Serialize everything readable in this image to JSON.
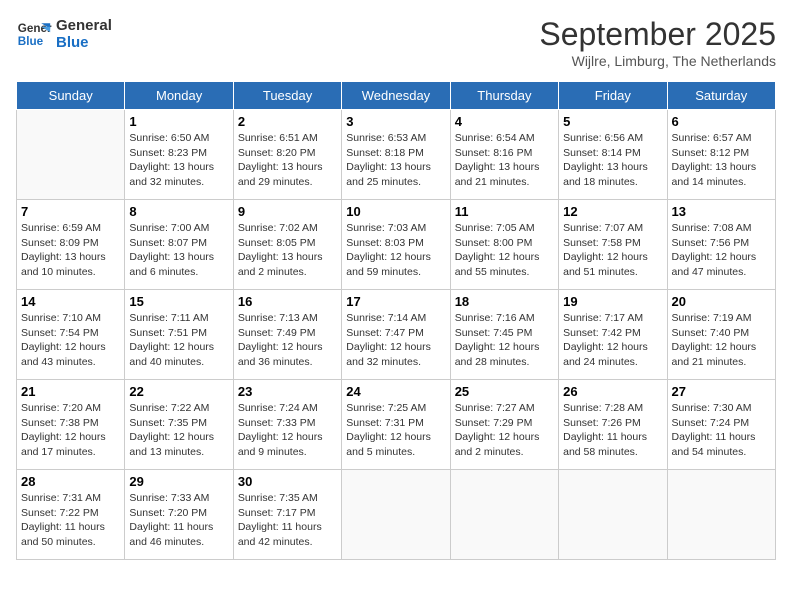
{
  "logo": {
    "line1": "General",
    "line2": "Blue"
  },
  "title": "September 2025",
  "subtitle": "Wijlre, Limburg, The Netherlands",
  "days_of_week": [
    "Sunday",
    "Monday",
    "Tuesday",
    "Wednesday",
    "Thursday",
    "Friday",
    "Saturday"
  ],
  "weeks": [
    [
      {
        "day": "",
        "info": ""
      },
      {
        "day": "1",
        "info": "Sunrise: 6:50 AM\nSunset: 8:23 PM\nDaylight: 13 hours\nand 32 minutes."
      },
      {
        "day": "2",
        "info": "Sunrise: 6:51 AM\nSunset: 8:20 PM\nDaylight: 13 hours\nand 29 minutes."
      },
      {
        "day": "3",
        "info": "Sunrise: 6:53 AM\nSunset: 8:18 PM\nDaylight: 13 hours\nand 25 minutes."
      },
      {
        "day": "4",
        "info": "Sunrise: 6:54 AM\nSunset: 8:16 PM\nDaylight: 13 hours\nand 21 minutes."
      },
      {
        "day": "5",
        "info": "Sunrise: 6:56 AM\nSunset: 8:14 PM\nDaylight: 13 hours\nand 18 minutes."
      },
      {
        "day": "6",
        "info": "Sunrise: 6:57 AM\nSunset: 8:12 PM\nDaylight: 13 hours\nand 14 minutes."
      }
    ],
    [
      {
        "day": "7",
        "info": "Sunrise: 6:59 AM\nSunset: 8:09 PM\nDaylight: 13 hours\nand 10 minutes."
      },
      {
        "day": "8",
        "info": "Sunrise: 7:00 AM\nSunset: 8:07 PM\nDaylight: 13 hours\nand 6 minutes."
      },
      {
        "day": "9",
        "info": "Sunrise: 7:02 AM\nSunset: 8:05 PM\nDaylight: 13 hours\nand 2 minutes."
      },
      {
        "day": "10",
        "info": "Sunrise: 7:03 AM\nSunset: 8:03 PM\nDaylight: 12 hours\nand 59 minutes."
      },
      {
        "day": "11",
        "info": "Sunrise: 7:05 AM\nSunset: 8:00 PM\nDaylight: 12 hours\nand 55 minutes."
      },
      {
        "day": "12",
        "info": "Sunrise: 7:07 AM\nSunset: 7:58 PM\nDaylight: 12 hours\nand 51 minutes."
      },
      {
        "day": "13",
        "info": "Sunrise: 7:08 AM\nSunset: 7:56 PM\nDaylight: 12 hours\nand 47 minutes."
      }
    ],
    [
      {
        "day": "14",
        "info": "Sunrise: 7:10 AM\nSunset: 7:54 PM\nDaylight: 12 hours\nand 43 minutes."
      },
      {
        "day": "15",
        "info": "Sunrise: 7:11 AM\nSunset: 7:51 PM\nDaylight: 12 hours\nand 40 minutes."
      },
      {
        "day": "16",
        "info": "Sunrise: 7:13 AM\nSunset: 7:49 PM\nDaylight: 12 hours\nand 36 minutes."
      },
      {
        "day": "17",
        "info": "Sunrise: 7:14 AM\nSunset: 7:47 PM\nDaylight: 12 hours\nand 32 minutes."
      },
      {
        "day": "18",
        "info": "Sunrise: 7:16 AM\nSunset: 7:45 PM\nDaylight: 12 hours\nand 28 minutes."
      },
      {
        "day": "19",
        "info": "Sunrise: 7:17 AM\nSunset: 7:42 PM\nDaylight: 12 hours\nand 24 minutes."
      },
      {
        "day": "20",
        "info": "Sunrise: 7:19 AM\nSunset: 7:40 PM\nDaylight: 12 hours\nand 21 minutes."
      }
    ],
    [
      {
        "day": "21",
        "info": "Sunrise: 7:20 AM\nSunset: 7:38 PM\nDaylight: 12 hours\nand 17 minutes."
      },
      {
        "day": "22",
        "info": "Sunrise: 7:22 AM\nSunset: 7:35 PM\nDaylight: 12 hours\nand 13 minutes."
      },
      {
        "day": "23",
        "info": "Sunrise: 7:24 AM\nSunset: 7:33 PM\nDaylight: 12 hours\nand 9 minutes."
      },
      {
        "day": "24",
        "info": "Sunrise: 7:25 AM\nSunset: 7:31 PM\nDaylight: 12 hours\nand 5 minutes."
      },
      {
        "day": "25",
        "info": "Sunrise: 7:27 AM\nSunset: 7:29 PM\nDaylight: 12 hours\nand 2 minutes."
      },
      {
        "day": "26",
        "info": "Sunrise: 7:28 AM\nSunset: 7:26 PM\nDaylight: 11 hours\nand 58 minutes."
      },
      {
        "day": "27",
        "info": "Sunrise: 7:30 AM\nSunset: 7:24 PM\nDaylight: 11 hours\nand 54 minutes."
      }
    ],
    [
      {
        "day": "28",
        "info": "Sunrise: 7:31 AM\nSunset: 7:22 PM\nDaylight: 11 hours\nand 50 minutes."
      },
      {
        "day": "29",
        "info": "Sunrise: 7:33 AM\nSunset: 7:20 PM\nDaylight: 11 hours\nand 46 minutes."
      },
      {
        "day": "30",
        "info": "Sunrise: 7:35 AM\nSunset: 7:17 PM\nDaylight: 11 hours\nand 42 minutes."
      },
      {
        "day": "",
        "info": ""
      },
      {
        "day": "",
        "info": ""
      },
      {
        "day": "",
        "info": ""
      },
      {
        "day": "",
        "info": ""
      }
    ]
  ]
}
